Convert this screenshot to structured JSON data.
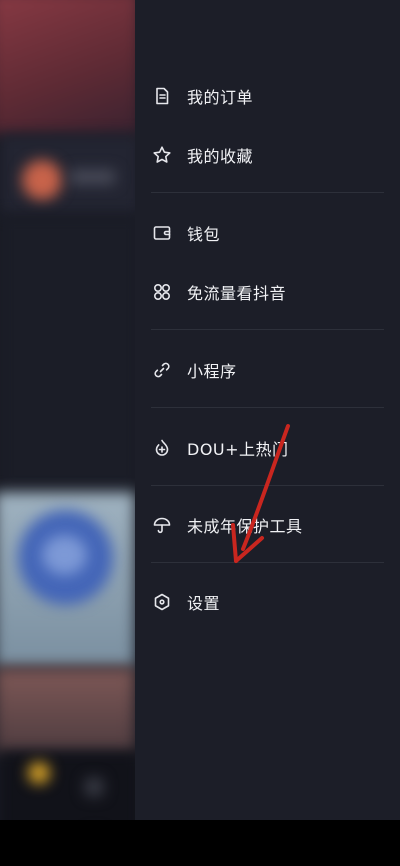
{
  "menu": {
    "items": [
      {
        "label": "我的订单",
        "icon": "document-icon"
      },
      {
        "label": "我的收藏",
        "icon": "star-icon"
      },
      {
        "label": "钱包",
        "icon": "wallet-icon"
      },
      {
        "label": "免流量看抖音",
        "icon": "clover-icon"
      },
      {
        "label": "小程序",
        "icon": "link-icon"
      },
      {
        "label": "DOU+上热门",
        "icon": "flame-plus-icon"
      },
      {
        "label": "未成年保护工具",
        "icon": "umbrella-icon"
      },
      {
        "label": "设置",
        "icon": "hexagon-settings-icon"
      }
    ]
  },
  "colors": {
    "drawer_bg": "#1c1e28",
    "text": "#f1f2f5",
    "divider": "#2d303a",
    "annotation_arrow": "#c9261f"
  }
}
